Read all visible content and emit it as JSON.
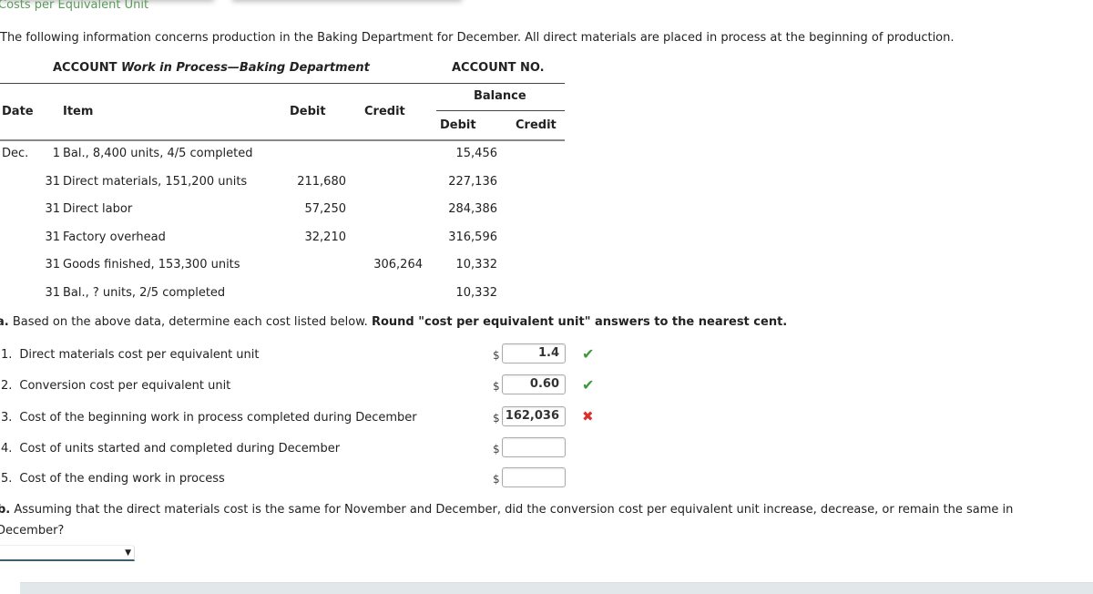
{
  "page": {
    "title": "Costs per Equivalent Unit",
    "intro": "The following information concerns production in the Baking Department for December. All direct materials are placed in process at the beginning of production."
  },
  "ledger": {
    "account_prefix": "ACCOUNT",
    "account_name": "Work in Process—Baking Department",
    "account_no_label": "ACCOUNT NO.",
    "headers": {
      "date": "Date",
      "item": "Item",
      "debit": "Debit",
      "credit": "Credit",
      "balance": "Balance",
      "balance_debit": "Debit",
      "balance_credit": "Credit"
    },
    "rows": [
      {
        "month": "Dec.",
        "day": "1",
        "item": "Bal., 8,400 units, 4/5 completed",
        "debit": "",
        "credit": "",
        "bal_debit": "15,456",
        "bal_credit": ""
      },
      {
        "month": "",
        "day": "31",
        "item": "Direct materials, 151,200 units",
        "debit": "211,680",
        "credit": "",
        "bal_debit": "227,136",
        "bal_credit": ""
      },
      {
        "month": "",
        "day": "31",
        "item": "Direct labor",
        "debit": "57,250",
        "credit": "",
        "bal_debit": "284,386",
        "bal_credit": ""
      },
      {
        "month": "",
        "day": "31",
        "item": "Factory overhead",
        "debit": "32,210",
        "credit": "",
        "bal_debit": "316,596",
        "bal_credit": ""
      },
      {
        "month": "",
        "day": "31",
        "item": "Goods finished, 153,300 units",
        "debit": "",
        "credit": "306,264",
        "bal_debit": "10,332",
        "bal_credit": ""
      },
      {
        "month": "",
        "day": "31",
        "item": "Bal., ? units, 2/5 completed",
        "debit": "",
        "credit": "",
        "bal_debit": "10,332",
        "bal_credit": ""
      }
    ]
  },
  "part_a": {
    "label": "a.",
    "instruction": "Based on the above data, determine each cost listed below.",
    "instruction_bold": "Round \"cost per equivalent unit\" answers to the nearest cent.",
    "currency_symbol": "$",
    "questions": [
      {
        "number": "1.",
        "text": "Direct materials cost per equivalent unit",
        "value": "1.4",
        "status": "correct"
      },
      {
        "number": "2.",
        "text": "Conversion cost per equivalent unit",
        "value": "0.60",
        "status": "correct"
      },
      {
        "number": "3.",
        "text": "Cost of the beginning work in process completed during December",
        "value": "162,036",
        "status": "incorrect"
      },
      {
        "number": "4.",
        "text": "Cost of units started and completed during December",
        "value": "",
        "status": "none"
      },
      {
        "number": "5.",
        "text": "Cost of the ending work in process",
        "value": "",
        "status": "none"
      }
    ],
    "status_icons": {
      "correct": "✔",
      "incorrect": "✖"
    },
    "status_colors": {
      "correct": "#3a9a3a",
      "incorrect": "#d9322e"
    }
  },
  "part_b": {
    "label": "b.",
    "question_line1": "Assuming that the direct materials cost is the same for November and December, did the conversion cost per equivalent unit increase, decrease, or remain the same in",
    "question_line2": "December?",
    "selected_value": ""
  }
}
